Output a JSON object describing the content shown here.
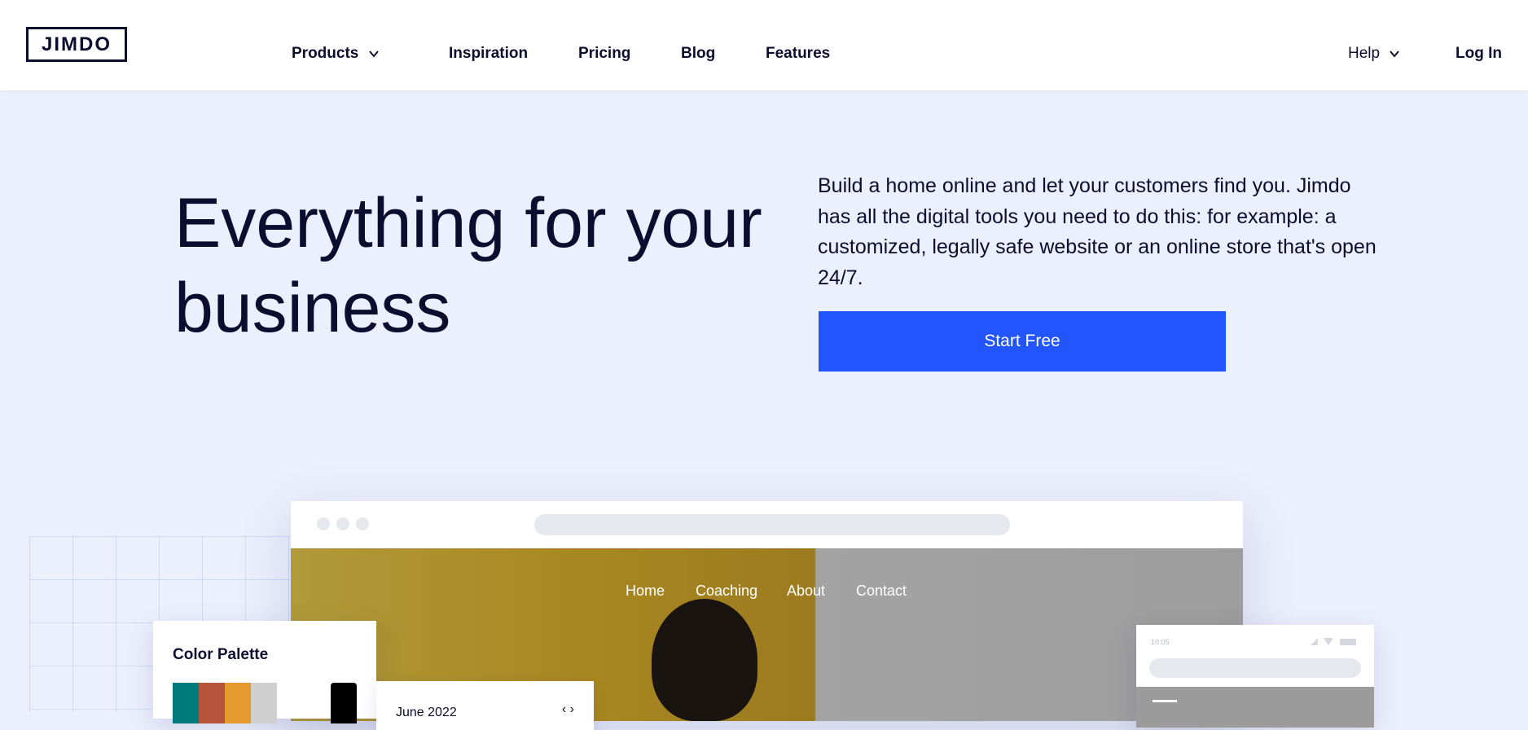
{
  "header": {
    "logo": "JIMDO",
    "nav": [
      {
        "label": "Products",
        "has_dropdown": true
      },
      {
        "label": "Inspiration"
      },
      {
        "label": "Pricing"
      },
      {
        "label": "Blog"
      },
      {
        "label": "Features"
      }
    ],
    "help": "Help",
    "login": "Log In"
  },
  "hero": {
    "title_line1": "Everything for your",
    "title_line2": "business",
    "description": "Build a home online and let your customers find you. Jimdo has all the digital tools you need to do this: for example: a customized, legally safe website or an online store that's open 24/7.",
    "cta": "Start Free"
  },
  "mockup": {
    "site_nav": [
      "Home",
      "Coaching",
      "About",
      "Contact"
    ],
    "palette": {
      "title": "Color Palette",
      "colors": [
        "#007a7a",
        "#b5543a",
        "#e59a2f",
        "#cfcfcf",
        "#000000"
      ]
    },
    "calendar": {
      "label": "June 2022",
      "arrows": "‹ ›"
    },
    "mobile": {
      "time": "10:05"
    }
  },
  "colors": {
    "background": "#eceffc",
    "primary": "#2355ff",
    "text": "#0b0e2e"
  }
}
